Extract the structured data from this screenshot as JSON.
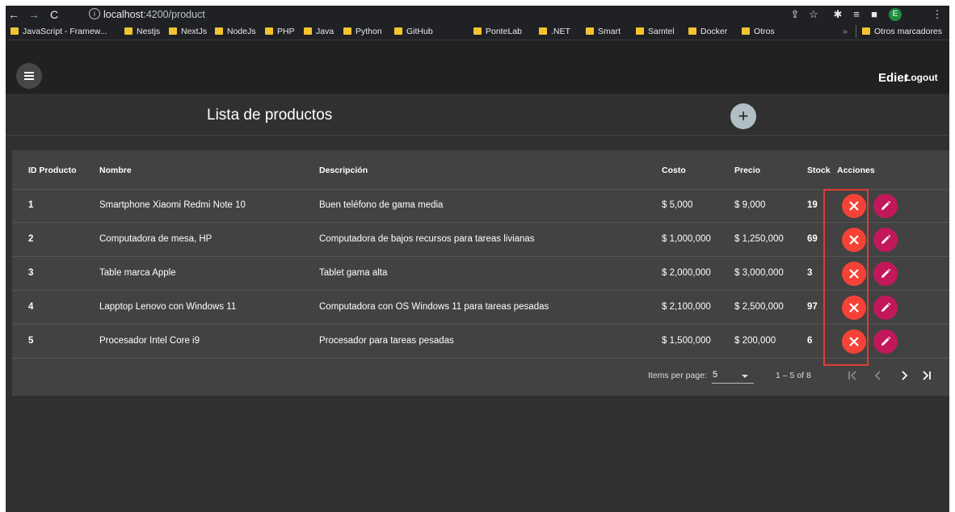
{
  "browser": {
    "url_host": "localhost",
    "url_rest": ":4200/product",
    "profile_initial": "E"
  },
  "bookmarks": {
    "items": [
      "JavaScript - Framew...",
      "Nestjs",
      "NextJs",
      "NodeJs",
      "PHP",
      "Java",
      "Python",
      "GitHub",
      "PonteLab",
      ".NET",
      "Smart",
      "Samtel",
      "Docker",
      "Otros"
    ],
    "overflow": "»",
    "other": "Otros marcadores"
  },
  "toolbar": {
    "username": "Edier",
    "logout_label": "Logout"
  },
  "page": {
    "title": "Lista de productos",
    "add_label": "+"
  },
  "table": {
    "headers": {
      "id": "ID Producto",
      "name": "Nombre",
      "description": "Descripción",
      "cost": "Costo",
      "price": "Precio",
      "stock": "Stock",
      "actions": "Acciones"
    },
    "rows": [
      {
        "id": "1",
        "name": "Smartphone Xiaomi Redmi Note 10",
        "description": "Buen teléfono de gama media",
        "cost": "$ 5,000",
        "price": "$ 9,000",
        "stock": "19"
      },
      {
        "id": "2",
        "name": "Computadora de mesa, HP",
        "description": "Computadora de bajos recursos para tareas livianas",
        "cost": "$ 1,000,000",
        "price": "$ 1,250,000",
        "stock": "69"
      },
      {
        "id": "3",
        "name": "Table marca Apple",
        "description": "Tablet gama alta",
        "cost": "$ 2,000,000",
        "price": "$ 3,000,000",
        "stock": "3"
      },
      {
        "id": "4",
        "name": "Lapptop Lenovo con Windows 11",
        "description": "Computadora con OS Windows 11 para tareas pesadas",
        "cost": "$ 2,100,000",
        "price": "$ 2,500,000",
        "stock": "97"
      },
      {
        "id": "5",
        "name": "Procesador Intel Core i9",
        "description": "Procesador para tareas pesadas",
        "cost": "$ 1,500,000",
        "price": "$ 200,000",
        "stock": "6"
      }
    ]
  },
  "paginator": {
    "items_per_page_label": "Items per page:",
    "items_per_page_value": "5",
    "range_label": "1 – 5 of 8"
  },
  "colors": {
    "delete": "#f44336",
    "edit": "#c2185b",
    "highlight": "#e53935"
  }
}
